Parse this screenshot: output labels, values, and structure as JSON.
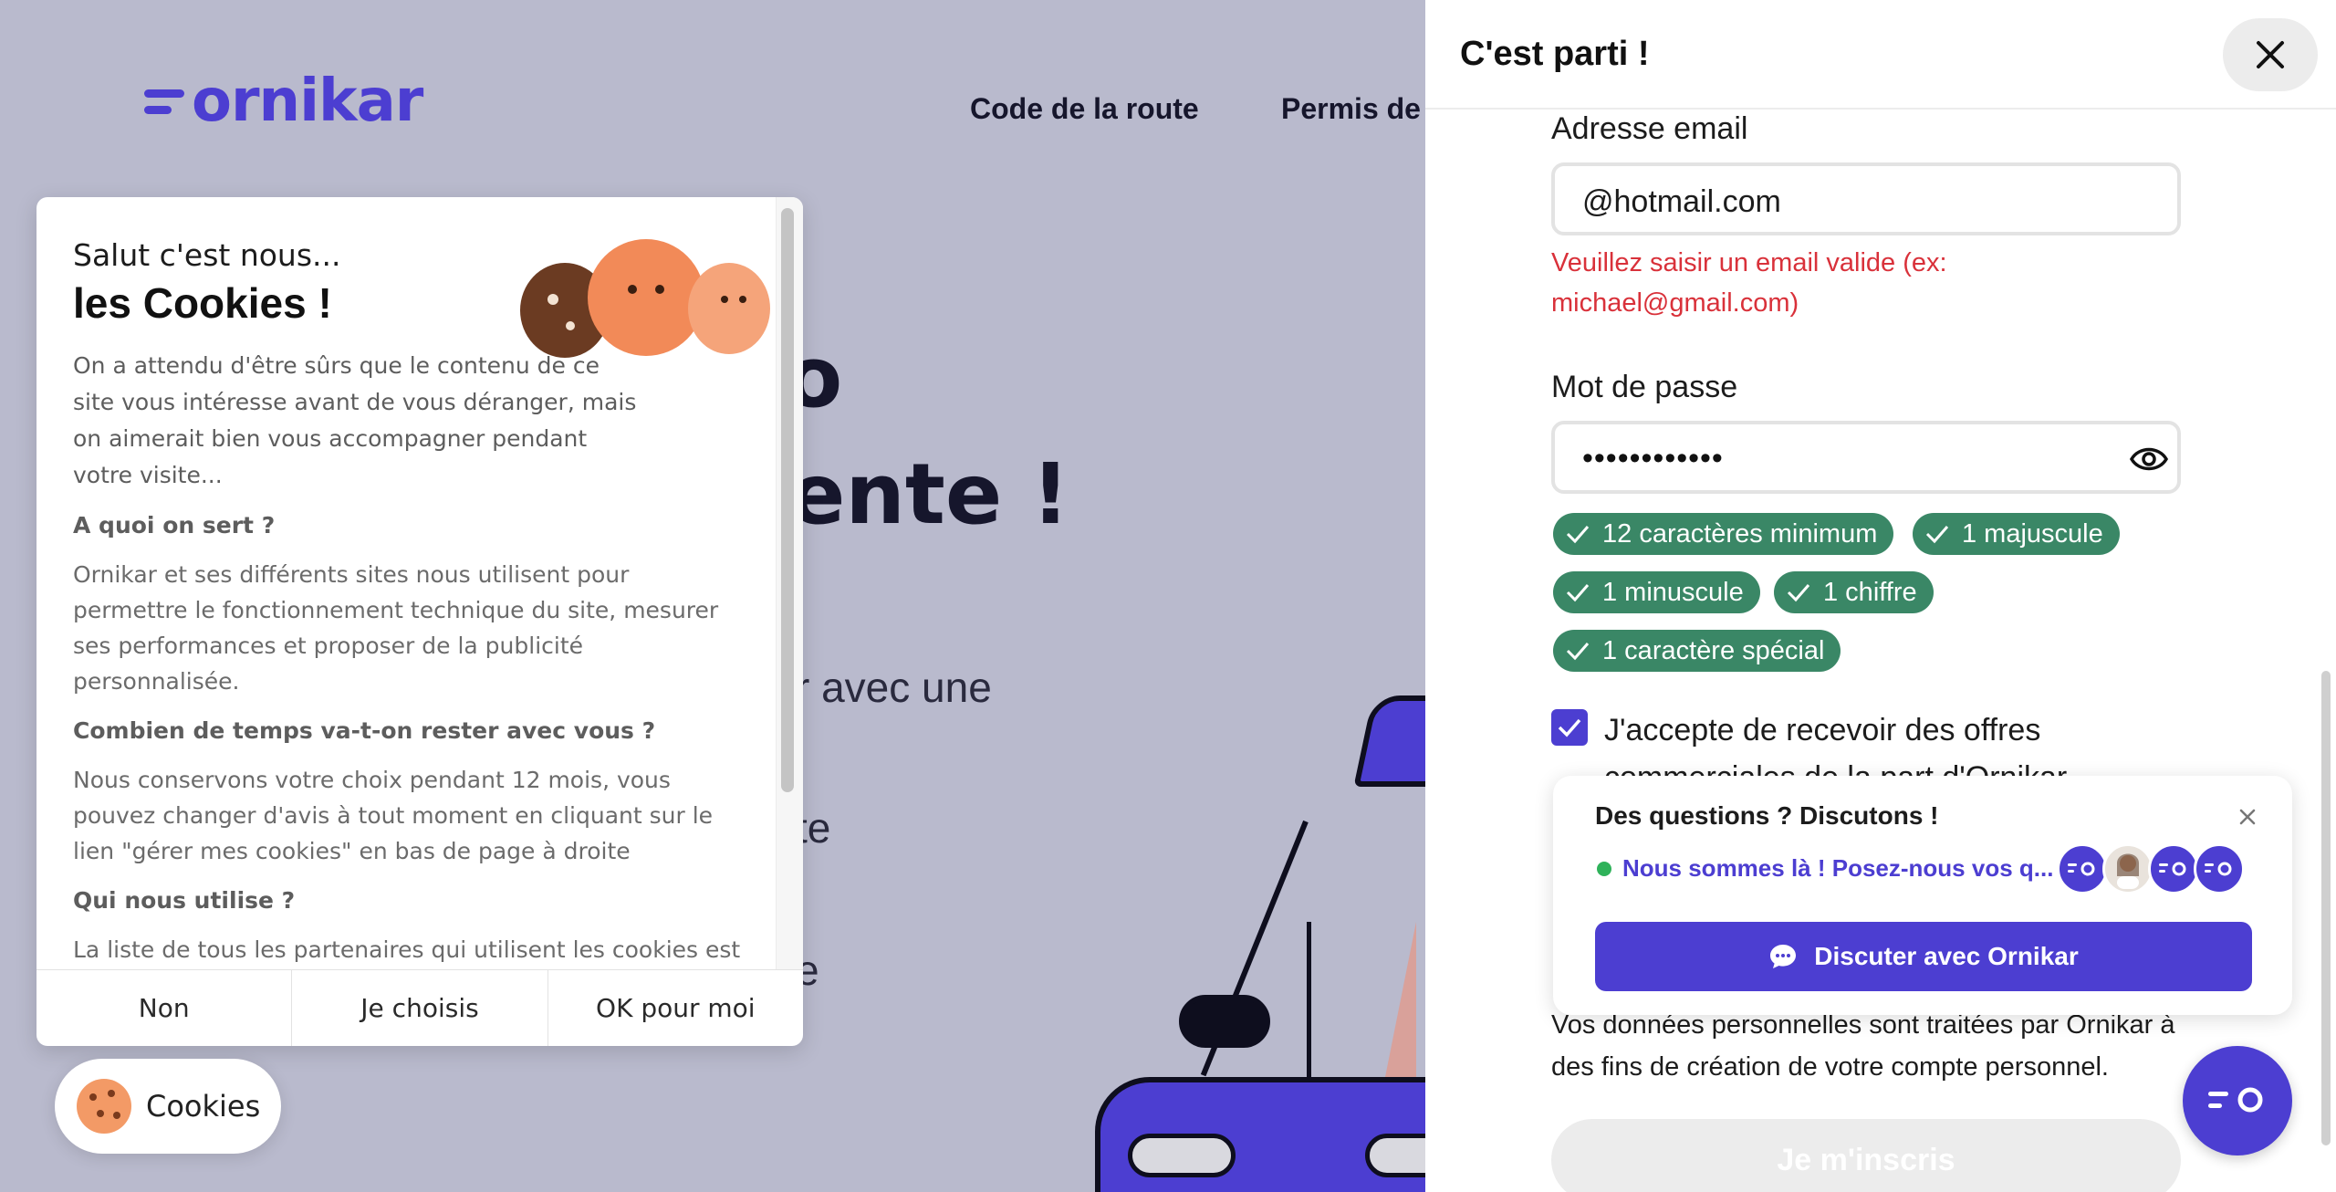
{
  "colors": {
    "brand": "#4c3ed1",
    "overlay_bg": "#b9bacd",
    "error": "#d9313a",
    "success_chip": "#3a8766",
    "online": "#2fb25a"
  },
  "background_page": {
    "logo": "ornikar",
    "nav": [
      "Code de la route",
      "Permis de"
    ],
    "hero_lines": [
      "o",
      "ente !"
    ],
    "hero_subs": [
      "r avec une",
      "te",
      "e"
    ]
  },
  "cookie_modal": {
    "greeting": "Salut c'est nous...",
    "title": "les Cookies !",
    "intro": "On a attendu d'être sûrs que le contenu de ce site vous intéresse avant de vous déranger, mais on aimerait bien vous accompagner pendant votre visite...",
    "sections": [
      {
        "heading": "A quoi on sert ?",
        "text": "Ornikar et ses différents sites nous utilisent pour permettre le fonctionnement technique du site, mesurer ses performances et proposer de la publicité personnalisée."
      },
      {
        "heading": "Combien de temps va-t-on rester avec vous ?",
        "text": "Nous conservons votre choix pendant 12 mois, vous pouvez changer d'avis à tout moment en cliquant sur le lien \"gérer mes cookies\" en bas de page à droite"
      },
      {
        "heading": "Qui nous utilise ?",
        "text": "La liste de tous les partenaires qui utilisent les cookies est"
      }
    ],
    "buttons": {
      "no": "Non",
      "choose": "Je choisis",
      "ok": "OK pour moi"
    }
  },
  "cookie_pill": {
    "label": "Cookies",
    "icon": "cookie-icon"
  },
  "signup_panel": {
    "title": "C'est parti !",
    "email": {
      "label": "Adresse email",
      "value": "@hotmail.com",
      "error": "Veuillez saisir un email valide (ex: michael@gmail.com)"
    },
    "password": {
      "label": "Mot de passe",
      "value": "••••••••••••",
      "icon": "eye-icon"
    },
    "requirements": [
      "12 caractères minimum",
      "1 majuscule",
      "1 minuscule",
      "1 chiffre",
      "1 caractère spécial"
    ],
    "consent": "J'accepte de recevoir des offres commerciales de la part d'Ornikar",
    "privacy": "Vos données personnelles sont traitées par Ornikar à des fins de création de votre compte personnel.",
    "submit": "Je m'inscris"
  },
  "chat_widget": {
    "title": "Des questions ? Discutons !",
    "status": "Nous sommes là ! Posez-nous vos q...",
    "button": "Discuter avec Ornikar"
  }
}
